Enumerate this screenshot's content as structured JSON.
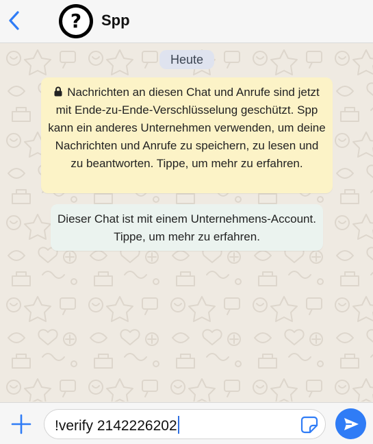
{
  "header": {
    "back_icon": "chevron-left-icon",
    "avatar_glyph": "?",
    "contact_name": "Spp"
  },
  "chat": {
    "date_chip": "Heute",
    "encryption_notice": "Nachrichten an diesen Chat und Anrufe sind jetzt mit Ende-zu-Ende-Verschlüsselung geschützt. Spp kann ein anderes Unternehmen verwenden, um deine Nachrichten und Anrufe zu speichern, zu lesen und zu beantworten. Tippe, um mehr zu erfahren.",
    "business_notice": "Dieser Chat ist mit einem Unternehmens-Account. Tippe, um mehr zu erfahren."
  },
  "composer": {
    "attach_icon": "plus-icon",
    "input_value": "!verify 2142226202",
    "sticker_icon": "sticker-icon",
    "send_icon": "send-icon"
  },
  "colors": {
    "accent": "#2f7cf6",
    "chat_background": "#efeae2",
    "encryption_bubble": "#fcf3c7",
    "business_bubble": "#ebf3ef",
    "date_chip": "#dfe3ef"
  }
}
